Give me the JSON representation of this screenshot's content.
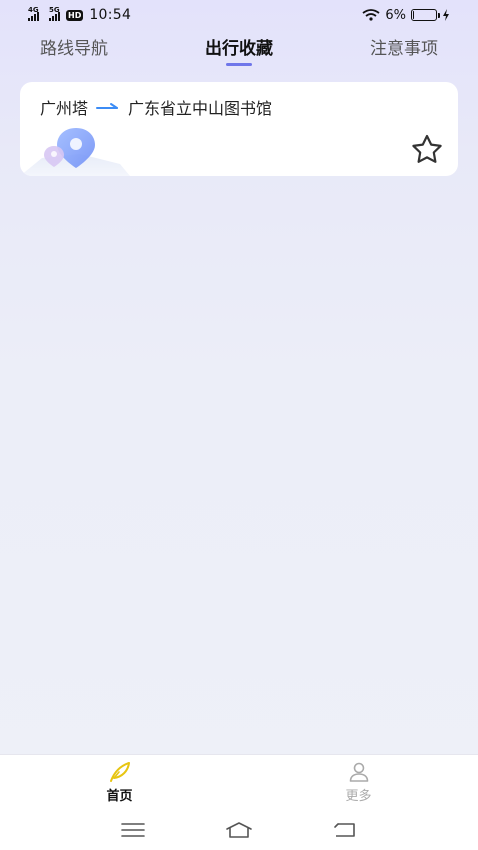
{
  "status_bar": {
    "net1": "4G",
    "net2": "5G",
    "hd": "HD",
    "time": "10:54",
    "battery_text": "6%",
    "battery_level": 0.06
  },
  "tabs": [
    {
      "label": "路线导航",
      "active": false
    },
    {
      "label": "出行收藏",
      "active": true
    },
    {
      "label": "注意事项",
      "active": false
    }
  ],
  "favorites": [
    {
      "from": "广州塔",
      "to": "广东省立中山图书馆"
    }
  ],
  "bottom_nav": [
    {
      "label": "首页",
      "active": true
    },
    {
      "label": "更多",
      "active": false
    }
  ],
  "colors": {
    "accent": "#6f76ea",
    "route_arrow": "#3c8cf5",
    "home_icon": "#f2d31b"
  }
}
